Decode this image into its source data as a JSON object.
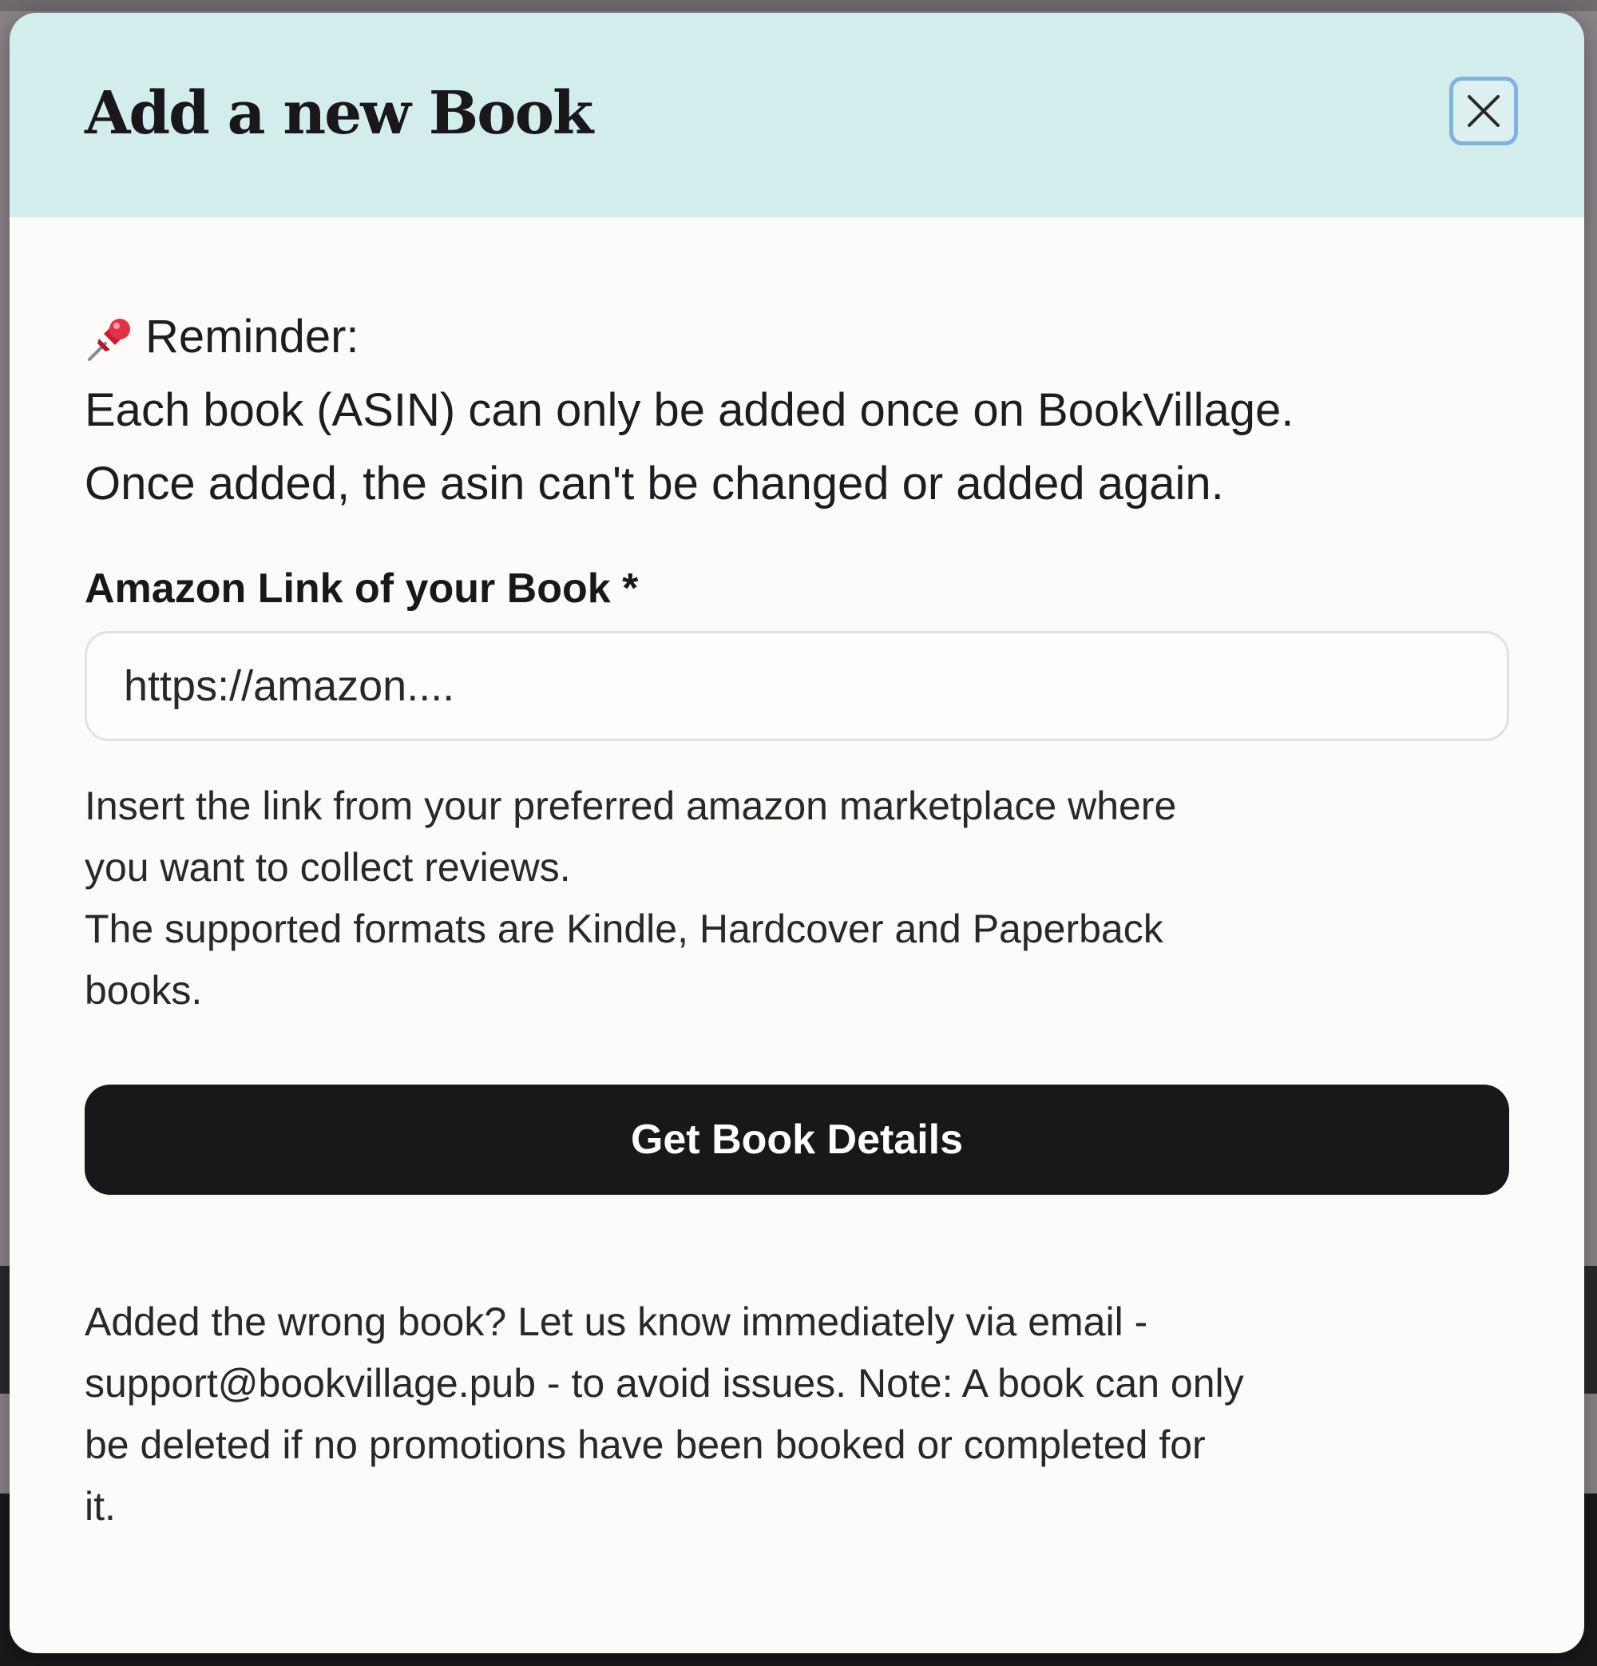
{
  "modal": {
    "title": "Add a new Book",
    "close_label": "×"
  },
  "reminder": {
    "icon": "pushpin-icon",
    "heading": "Reminder:",
    "lines": [
      "Each book (ASIN) can only be added once on BookVillage.",
      "Once added, the asin can't be changed or added again."
    ]
  },
  "form": {
    "field_label": "Amazon Link of your Book *",
    "input_value": "",
    "input_placeholder": "https://amazon....",
    "help_lines": [
      "Insert the link from your preferred amazon marketplace where",
      "you want to collect reviews.",
      "The supported formats are Kindle, Hardcover and Paperback",
      "books."
    ],
    "submit_label": "Get Book Details"
  },
  "footer": {
    "lines": [
      "Added the wrong book? Let us know immediately via email -",
      "support@bookvillage.pub - to avoid issues. Note: A book can only",
      "be deleted if no promotions have been booked or completed for",
      "it."
    ]
  },
  "colors": {
    "header_bg": "#d3eded",
    "modal_bg": "#fdfafa",
    "button_bg": "#1a171a",
    "close_border": "#7fb3de",
    "pin_red": "#d7263d"
  }
}
